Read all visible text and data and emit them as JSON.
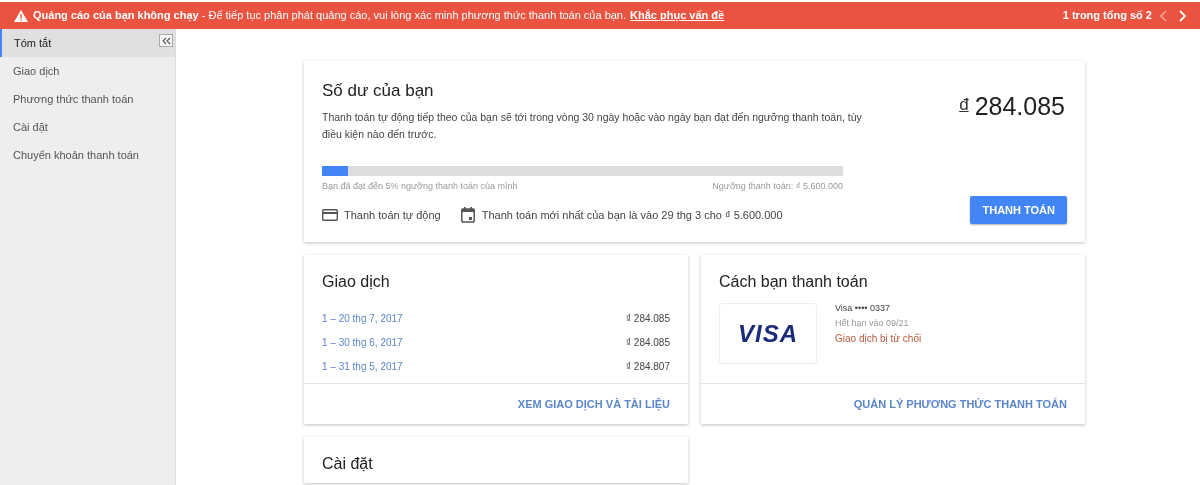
{
  "alert_banner": {
    "title": "Quảng cáo của bạn không chạy",
    "message": "- Để tiếp tục phân phát quảng cáo, vui lòng xác minh phương thức thanh toán của bạn.",
    "link": "Khắc phục vấn đề",
    "pager": "1 trong tổng số 2",
    "prev_disabled": true,
    "next_disabled": false
  },
  "sidebar": {
    "items": [
      {
        "label": "Tóm tắt",
        "selected": true
      },
      {
        "label": "Giao dịch",
        "selected": false
      },
      {
        "label": "Phương thức thanh toán",
        "selected": false
      },
      {
        "label": "Cài đặt",
        "selected": false
      },
      {
        "label": "Chuyển khoản thanh toán",
        "selected": false
      }
    ]
  },
  "balance_card": {
    "title": "Số dư của bạn",
    "description": "Thanh toán tự động tiếp theo của bạn sẽ tới trong vòng 30 ngày hoặc vào ngày bạn đạt đến ngưỡng thanh toán, tùy điều kiện nào đến trước.",
    "currency": "đ",
    "amount": "284.085",
    "progress": {
      "level": 0.05,
      "left_label": "Bạn đã đạt đến 5% ngưỡng thanh toán của mình",
      "right_label": "Ngưỡng thanh toán: ₫ 5.600.000"
    },
    "auto_payment": "Thanh toán tự động",
    "last_payment": "Thanh toán mới nhất của bạn là vào 29 thg 3 cho ₫ 5.600.000",
    "pay_button": "THANH TOÁN"
  },
  "transactions_card": {
    "title": "Giao dịch",
    "rows": [
      {
        "period": "1 – 20 thg 7, 2017",
        "amount": "₫ 284.085"
      },
      {
        "period": "1 – 30 thg 6, 2017",
        "amount": "₫ 284.085"
      },
      {
        "period": "1 – 31 thg 5, 2017",
        "amount": "₫ 284.807"
      }
    ],
    "action": "XEM GIAO DỊCH VÀ TÀI LIỆU"
  },
  "payment_method_card": {
    "title": "Cách bạn thanh toán",
    "card_logo": "VISA",
    "card_name": "Visa •••• 0337",
    "expiry": "Hết hạn vào 09/21",
    "status": "Giao dịch bị từ chối",
    "action": "QUẢN LÝ PHƯƠNG THỨC THANH TOÁN"
  },
  "settings_card": {
    "title": "Cài đặt"
  }
}
